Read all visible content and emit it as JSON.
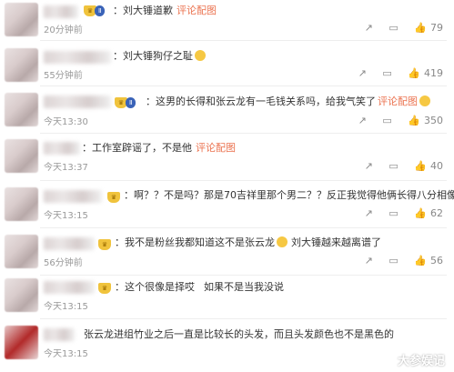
{
  "comments": [
    {
      "text": "：刘大锤道歉",
      "link": "评论配图",
      "time": "20分钟前",
      "likes": "79"
    },
    {
      "text": "：刘大锤狗仔之耻",
      "link": "",
      "time": "55分钟前",
      "likes": "419"
    },
    {
      "text": "：这男的长得和张云龙有一毛钱关系吗，给我气笑了",
      "link": "评论配图",
      "time": "今天13:30",
      "likes": "350"
    },
    {
      "text": "：工作室辟谣了，不是他",
      "link": "评论配图",
      "time": "今天13:37",
      "likes": "40"
    },
    {
      "text": "：啊？？不是吗？那是70吉祥里那个男二？？反正我觉得他俩长得八分相像",
      "link": "",
      "time": "今天13:15",
      "likes": "62"
    },
    {
      "text": "：我不是粉丝我都知道这不是张云龙",
      "text2": "刘大锤越来越离谱了",
      "link": "",
      "time": "56分钟前",
      "likes": "56"
    },
    {
      "text": "：这个很像是择哎",
      "text2": "如果不是当我没说",
      "link": "",
      "time": "今天13:15",
      "likes": ""
    },
    {
      "text": "张云龙进组竹业之后一直是比较长的头发，而且头发颜色也不是黑色的",
      "link": "",
      "time": "今天13:15",
      "likes": ""
    }
  ],
  "icons": {
    "reply": "reply-icon",
    "comment": "comment-icon",
    "like": "thumbs-up-icon"
  },
  "watermark": "大参娱记"
}
